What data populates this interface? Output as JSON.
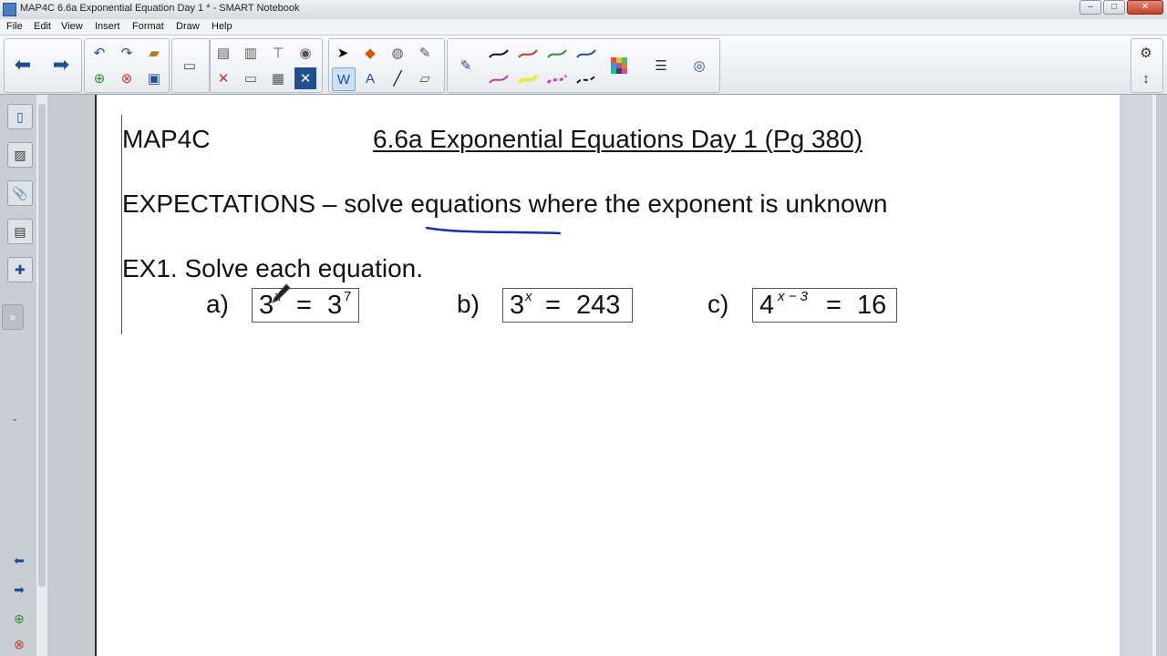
{
  "window": {
    "title": "MAP4C 6.6a Exponential Equation Day 1 * - SMART Notebook"
  },
  "menu": [
    "File",
    "Edit",
    "View",
    "Insert",
    "Format",
    "Draw",
    "Help"
  ],
  "toolbar": {
    "nav_icons": [
      "arrow-left-icon",
      "arrow-right-icon"
    ],
    "file_icons": [
      "undo-icon",
      "redo-icon",
      "open-icon",
      "add-page-icon",
      "delete-page-icon",
      "save-icon"
    ],
    "edit_icons": [
      "screen-capture-icon",
      "paste-icon",
      "screen-shade-icon",
      "delete-icon",
      "document-camera-icon",
      "table-icon",
      "full-screen-icon"
    ],
    "select_icons": [
      "select-icon",
      "shape-icon",
      "fill-icon",
      "magic-pen-icon",
      "creative-pen-icon",
      "text-icon",
      "line-icon",
      "eraser-icon"
    ],
    "pen_icons": [
      "pen-icon"
    ],
    "right_icons": [
      "gear-icon",
      "move-toolbar-icon"
    ]
  },
  "page": {
    "course": "MAP4C",
    "title": "6.6a Exponential Equations Day 1 (Pg 380)",
    "expectations": "EXPECTATIONS – solve equations where the exponent is unknown",
    "example": "EX1. Solve each equation.",
    "problems": [
      {
        "label": "a)",
        "base": "3",
        "exponent": "x",
        "equals": "=",
        "rhs_base": "3",
        "rhs_exponent": "7"
      },
      {
        "label": "b)",
        "base": "3",
        "exponent": "x",
        "equals": "=",
        "rhs": "243"
      },
      {
        "label": "c)",
        "base": "4",
        "exponent": "x − 3",
        "equals": "=",
        "rhs": "16"
      }
    ]
  },
  "colors": {
    "ink": "#111111",
    "annotation": "#1c2fb0",
    "accent": "#4a7fc1"
  }
}
